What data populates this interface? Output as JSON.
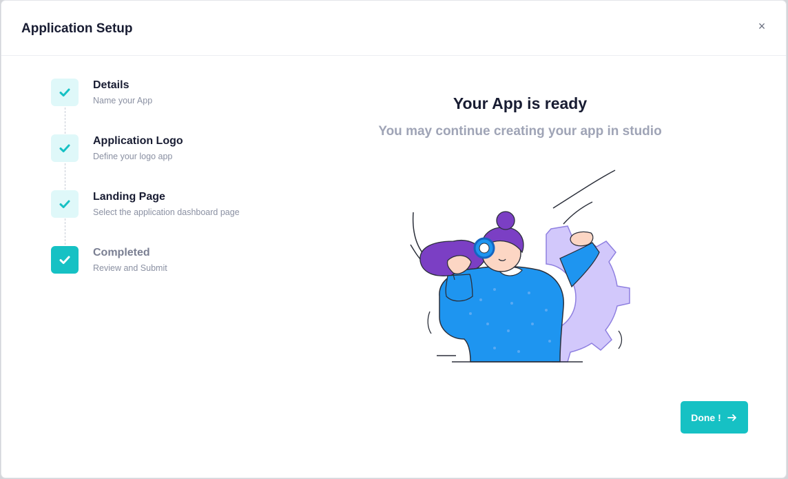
{
  "modal": {
    "title": "Application Setup",
    "close_label": "×"
  },
  "steps": [
    {
      "title": "Details",
      "description": "Name your App",
      "state": "done"
    },
    {
      "title": "Application Logo",
      "description": "Define your logo app",
      "state": "done"
    },
    {
      "title": "Landing Page",
      "description": "Select the application dashboard page",
      "state": "done"
    },
    {
      "title": "Completed",
      "description": "Review and Submit",
      "state": "current"
    }
  ],
  "content": {
    "title": "Your App is ready",
    "subtitle": "You may continue creating your app in studio",
    "illustration": "woman-with-gear-illustration"
  },
  "actions": {
    "done_label": "Done !",
    "done_icon": "arrow-right-icon"
  },
  "colors": {
    "accent": "#16c1c4",
    "accent_light": "#dff8f9",
    "title": "#181c32",
    "muted": "#9fa4b6"
  }
}
